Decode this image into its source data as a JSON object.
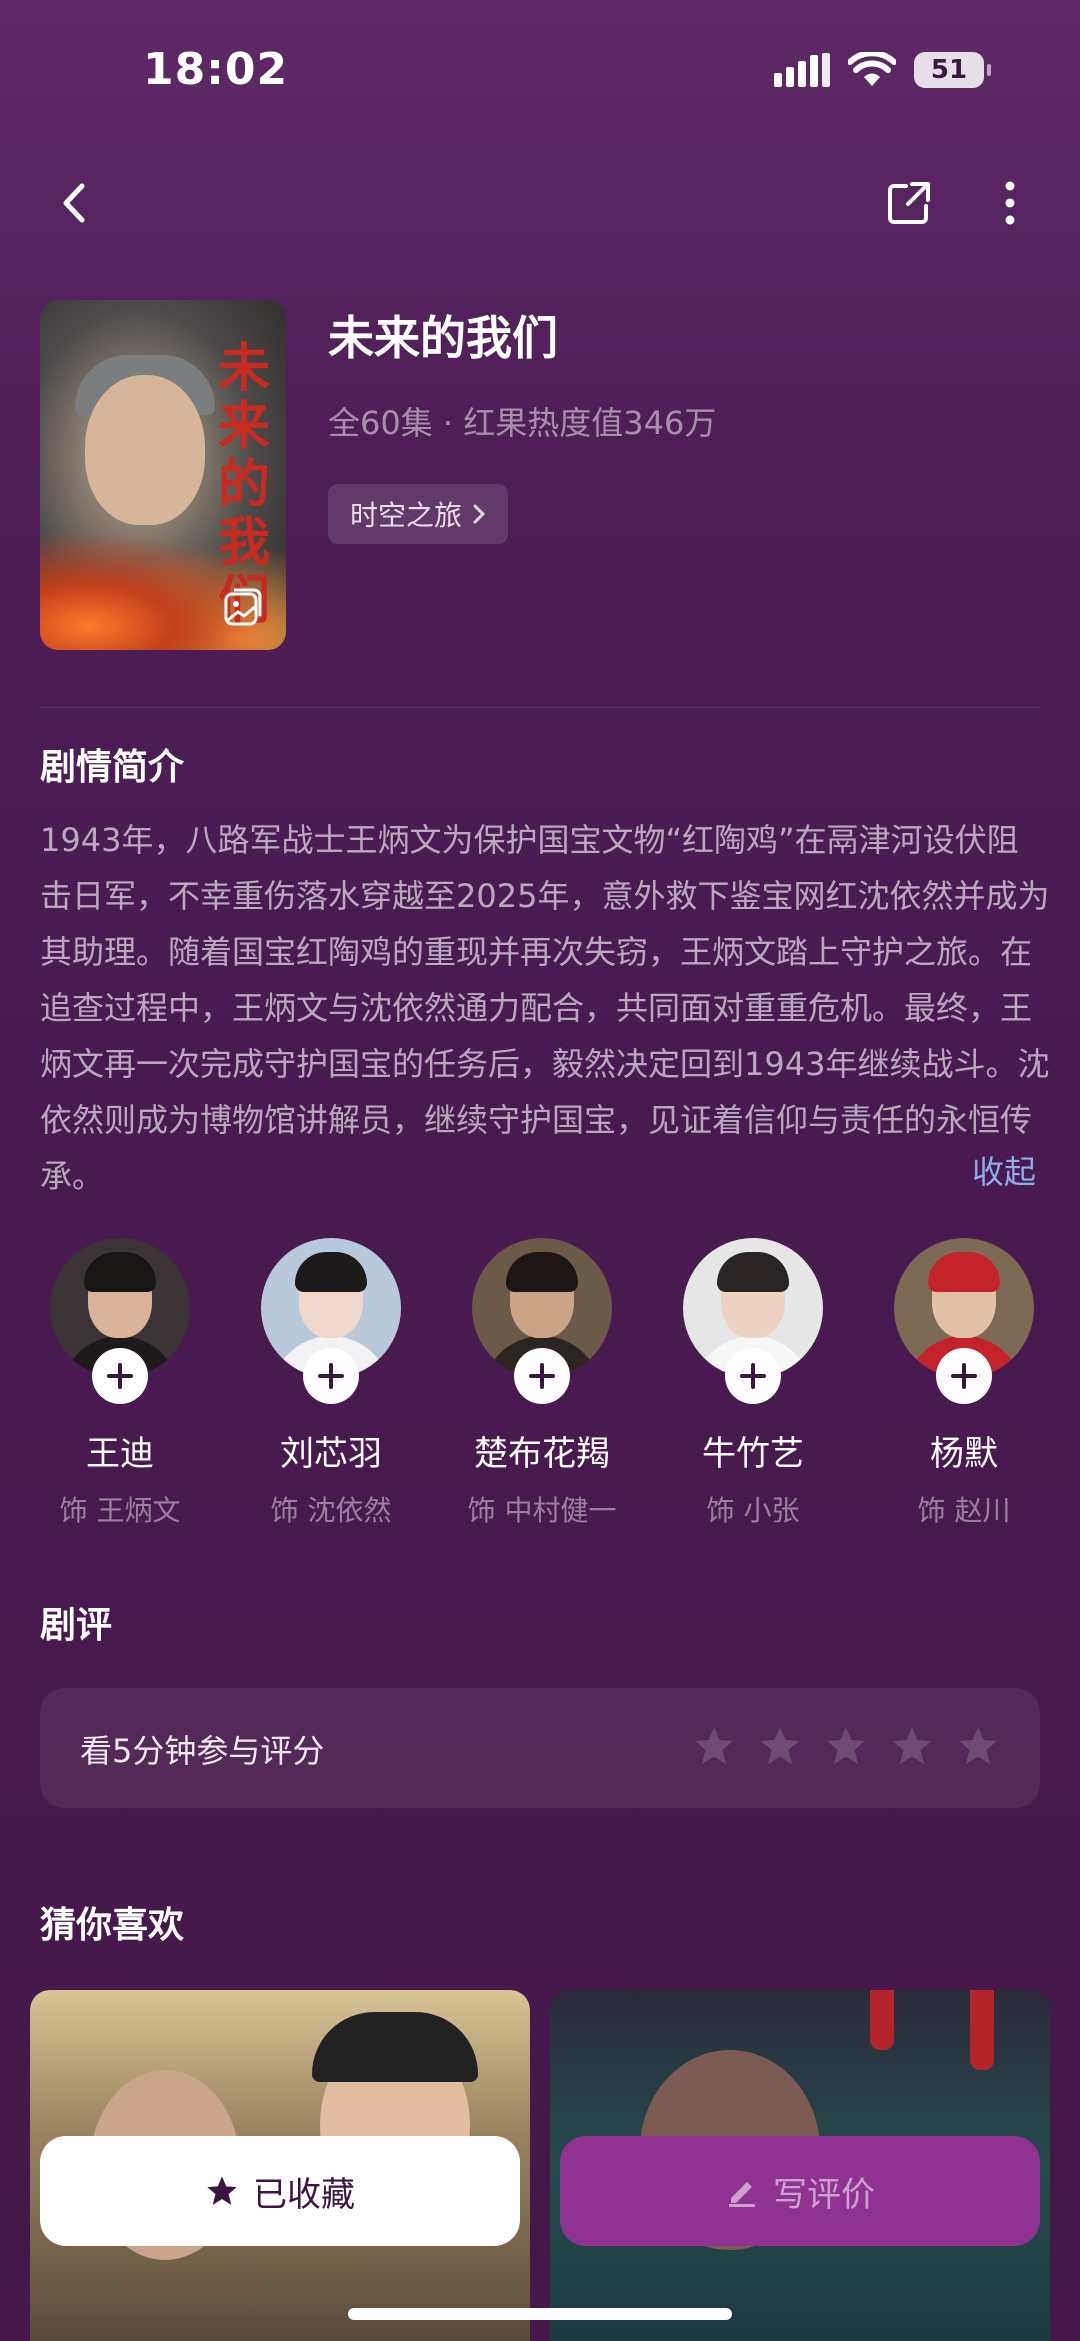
{
  "status_bar": {
    "time": "18:02",
    "battery": "51"
  },
  "show": {
    "title": "未来的我们",
    "meta": "全60集 · 红果热度值346万",
    "tag": "时空之旅",
    "poster_calligraphy": "未来的我们"
  },
  "synopsis": {
    "heading": "剧情简介",
    "text": "1943年，八路军战士王炳文为保护国宝文物“红陶鸡”在鬲津河设伏阻击日军，不幸重伤落水穿越至2025年，意外救下鉴宝网红沈依然并成为其助理。随着国宝红陶鸡的重现并再次失窃，王炳文踏上守护之旅。在追查过程中，王炳文与沈依然通力配合，共同面对重重危机。最终，王炳文再一次完成守护国宝的任务后，毅然决定回到1943年继续战斗。沈依然则成为博物馆讲解员，继续守护国宝，见证着信仰与责任的永恒传承。",
    "collapse_label": "收起"
  },
  "cast": [
    {
      "name": "王迪",
      "role": "饰 王炳文"
    },
    {
      "name": "刘芯羽",
      "role": "饰 沈依然"
    },
    {
      "name": "楚布花羯",
      "role": "饰 中村健一"
    },
    {
      "name": "牛竹艺",
      "role": "饰 小张"
    },
    {
      "name": "杨默",
      "role": "饰 赵川"
    }
  ],
  "review": {
    "heading": "剧评",
    "prompt": "看5分钟参与评分",
    "stars": 5
  },
  "recommend": {
    "heading": "猜你喜欢"
  },
  "actions": {
    "favorite_label": "已收藏",
    "write_review_label": "写评价"
  },
  "colors": {
    "background": "#4f1e57",
    "accent": "#8f3291",
    "link": "#8eaee8"
  }
}
